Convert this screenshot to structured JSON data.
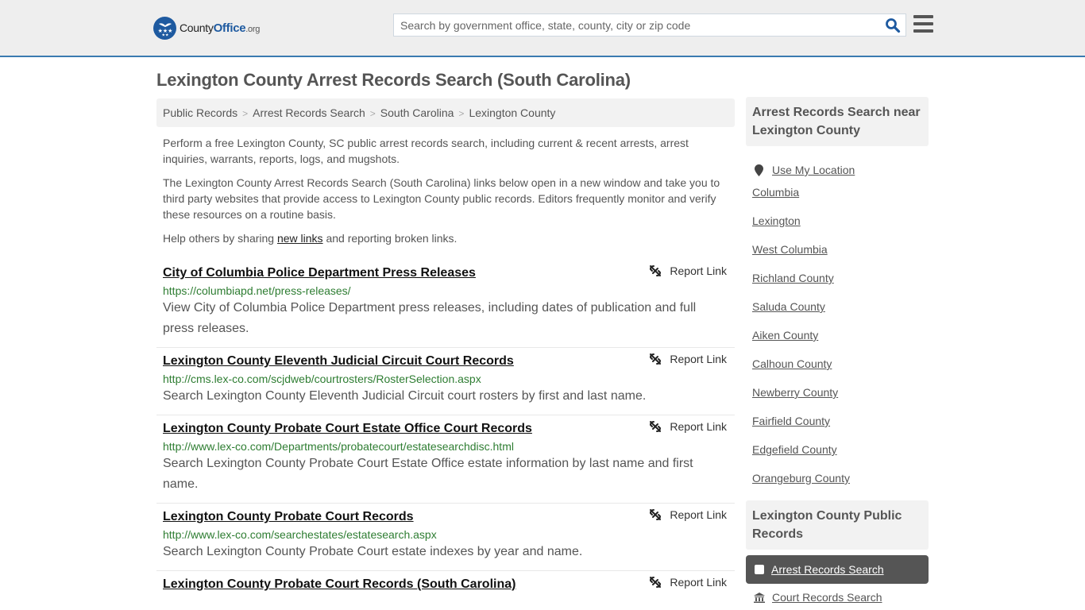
{
  "header": {
    "logo": {
      "part1": "County",
      "part2": "Office",
      "part3": ".org"
    },
    "search_placeholder": "Search by government office, state, county, city or zip code",
    "search_icon": "search-icon",
    "menu_icon": "hamburger-menu-icon"
  },
  "page": {
    "title": "Lexington County Arrest Records Search (South Carolina)"
  },
  "breadcrumb": [
    "Public Records",
    "Arrest Records Search",
    "South Carolina",
    "Lexington County"
  ],
  "intro": {
    "p1": "Perform a free Lexington County, SC public arrest records search, including current & recent arrests, arrest inquiries, warrants, reports, logs, and mugshots.",
    "p2": "The Lexington County Arrest Records Search (South Carolina) links below open in a new window and take you to third party websites that provide access to Lexington County public records. Editors frequently monitor and verify these resources on a routine basis.",
    "p3_before": "Help others by sharing ",
    "p3_link": "new links",
    "p3_after": " and reporting broken links."
  },
  "report_label": "Report Link",
  "results": [
    {
      "title": "City of Columbia Police Department Press Releases",
      "url": "https://columbiapd.net/press-releases/",
      "desc": "View City of Columbia Police Department press releases, including dates of publication and full press releases."
    },
    {
      "title": "Lexington County Eleventh Judicial Circuit Court Records",
      "url": "http://cms.lex-co.com/scjdweb/courtrosters/RosterSelection.aspx",
      "desc": "Search Lexington County Eleventh Judicial Circuit court rosters by first and last name."
    },
    {
      "title": "Lexington County Probate Court Estate Office Court Records",
      "url": "http://www.lex-co.com/Departments/probatecourt/estatesearchdisc.html",
      "desc": "Search Lexington County Probate Court Estate Office estate information by last name and first name."
    },
    {
      "title": "Lexington County Probate Court Records",
      "url": "http://www.lex-co.com/searchestates/estatesearch.aspx",
      "desc": "Search Lexington County Probate Court estate indexes by year and name."
    },
    {
      "title": "Lexington County Probate Court Records (South Carolina)",
      "url": "",
      "desc": ""
    }
  ],
  "sidebar": {
    "nearby_heading": "Arrest Records Search near Lexington County",
    "use_location": "Use My Location",
    "nearby": [
      "Columbia",
      "Lexington",
      "West Columbia",
      "Richland County",
      "Saluda County",
      "Aiken County",
      "Calhoun County",
      "Newberry County",
      "Fairfield County",
      "Edgefield County",
      "Orangeburg County"
    ],
    "public_heading": "Lexington County Public Records",
    "public_active": "Arrest Records Search",
    "public_next": "Court Records Search"
  },
  "colors": {
    "brand_blue": "#1e5aa0",
    "header_border": "#3a7ab0",
    "url_green": "#2e7d32",
    "active_bg": "#555555"
  }
}
